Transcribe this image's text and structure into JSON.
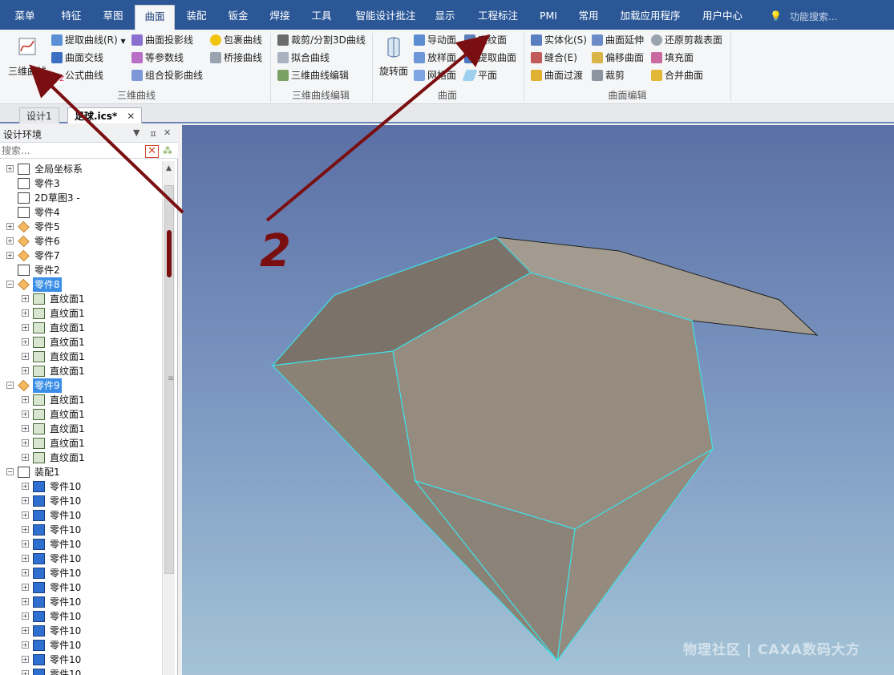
{
  "menu": {
    "tabs": [
      "菜单",
      "特征",
      "草图",
      "曲面",
      "装配",
      "钣金",
      "焊接",
      "工具",
      "智能设计批注",
      "显示",
      "工程标注",
      "PMI",
      "常用",
      "加载应用程序",
      "用户中心"
    ],
    "active": "曲面",
    "search_placeholder": "功能搜索..."
  },
  "ribbon": {
    "big_curve": "三维曲线",
    "g1": [
      "提取曲线(R)",
      "曲面交线",
      "公式曲线",
      "曲面投影线",
      "等参数线",
      "组合投影曲线",
      "包裹曲线",
      "桥接曲线"
    ],
    "g1_label": "三维曲线",
    "g2": [
      "裁剪/分割3D曲线",
      "拟合曲线",
      "三维曲线编辑"
    ],
    "g2_label": "三维曲线编辑",
    "big_revolve": "旋转面",
    "g3": [
      "导动面",
      "放样面",
      "网格面",
      "直纹面",
      "提取曲面",
      "平面"
    ],
    "g3_label": "曲面",
    "g4": [
      "实体化(S)",
      "缝合(E)",
      "曲面过渡",
      "曲面延伸",
      "偏移曲面",
      "裁剪",
      "还原剪裁表面",
      "填充面",
      "合并曲面"
    ],
    "g4_label": "曲面编辑"
  },
  "doc_tabs": [
    "设计1",
    "足球.ics*"
  ],
  "panel": {
    "title": "设计环境",
    "pin": "ㅍ",
    "close": "✕",
    "dropdown": "▼",
    "search_placeholder": "搜索..."
  },
  "tree": [
    {
      "label": "全局坐标系",
      "level": 0,
      "exp": "+"
    },
    {
      "label": "零件3",
      "level": 0,
      "exp": ""
    },
    {
      "label": "2D草图3 -",
      "level": 0,
      "exp": ""
    },
    {
      "label": "零件4",
      "level": 0,
      "exp": ""
    },
    {
      "label": "零件5",
      "level": 0,
      "exp": "+"
    },
    {
      "label": "零件6",
      "level": 0,
      "exp": "+"
    },
    {
      "label": "零件7",
      "level": 0,
      "exp": "+"
    },
    {
      "label": "零件2",
      "level": 0,
      "exp": ""
    },
    {
      "label": "零件8",
      "level": 0,
      "exp": "-",
      "selected": true
    },
    {
      "label": "直纹面1",
      "level": 1,
      "exp": "+"
    },
    {
      "label": "直纹面1",
      "level": 1,
      "exp": "+"
    },
    {
      "label": "直纹面1",
      "level": 1,
      "exp": "+"
    },
    {
      "label": "直纹面1",
      "level": 1,
      "exp": "+"
    },
    {
      "label": "直纹面1",
      "level": 1,
      "exp": "+"
    },
    {
      "label": "直纹面1",
      "level": 1,
      "exp": "+"
    },
    {
      "label": "零件9",
      "level": 0,
      "exp": "-",
      "selected": true
    },
    {
      "label": "直纹面1",
      "level": 1,
      "exp": "+"
    },
    {
      "label": "直纹面1",
      "level": 1,
      "exp": "+"
    },
    {
      "label": "直纹面1",
      "level": 1,
      "exp": "+"
    },
    {
      "label": "直纹面1",
      "level": 1,
      "exp": "+"
    },
    {
      "label": "直纹面1",
      "level": 1,
      "exp": "+"
    },
    {
      "label": "装配1",
      "level": 0,
      "exp": "-"
    },
    {
      "label": "零件10",
      "level": 1,
      "exp": "+"
    },
    {
      "label": "零件10",
      "level": 1,
      "exp": "+"
    },
    {
      "label": "零件10",
      "level": 1,
      "exp": "+"
    },
    {
      "label": "零件10",
      "level": 1,
      "exp": "+"
    },
    {
      "label": "零件10",
      "level": 1,
      "exp": "+"
    },
    {
      "label": "零件10",
      "level": 1,
      "exp": "+"
    },
    {
      "label": "零件10",
      "level": 1,
      "exp": "+"
    },
    {
      "label": "零件10",
      "level": 1,
      "exp": "+"
    },
    {
      "label": "零件10",
      "level": 1,
      "exp": "+"
    },
    {
      "label": "零件10",
      "level": 1,
      "exp": "+"
    },
    {
      "label": "零件10",
      "level": 1,
      "exp": "+"
    },
    {
      "label": "零件10",
      "level": 1,
      "exp": "+"
    },
    {
      "label": "零件10",
      "level": 1,
      "exp": "+"
    },
    {
      "label": "零件10",
      "level": 1,
      "exp": "+"
    }
  ],
  "annotation_text": "2",
  "watermark": "CAXA数码大方",
  "watermark_left": "物理社区",
  "watermark_sep": "|",
  "colors": {
    "menubar": "#2b5797",
    "selection": "#3a8ee6",
    "arrow": "#7a0f12",
    "face_edge": "#3fe0e8"
  }
}
